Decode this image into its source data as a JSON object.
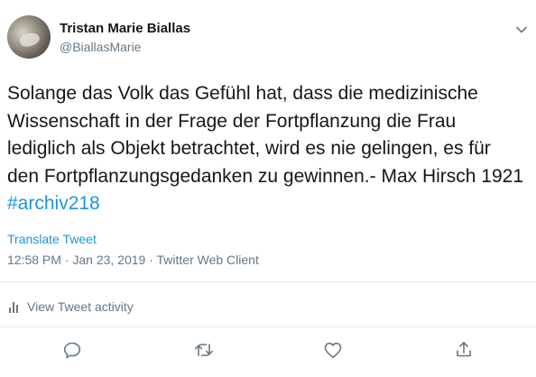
{
  "tweet": {
    "author_name": "Tristan Marie Biallas",
    "author_handle": "@BiallasMarie",
    "text_before_hashtag": "Solange das Volk das Gefühl hat, dass die medizinische Wissenschaft in der Frage der Fortpflanzung die Frau lediglich als Objekt betrachtet, wird es nie gelingen, es für den Fortpflanzungsgedanken zu gewinnen.- Max Hirsch 1921 ",
    "hashtag": "#archiv218",
    "translate_label": "Translate Tweet",
    "timestamp": "12:58 PM · Jan 23, 2019 · Twitter Web Client",
    "activity_label": "View Tweet activity"
  },
  "icons": {
    "caret": "chevron-down-icon",
    "activity": "bar-chart-icon",
    "reply": "reply-icon",
    "retweet": "retweet-icon",
    "like": "heart-icon",
    "share": "share-icon"
  },
  "colors": {
    "text": "#14171a",
    "secondary": "#657786",
    "link": "#1b95e0",
    "divider": "#e6ecf0"
  }
}
